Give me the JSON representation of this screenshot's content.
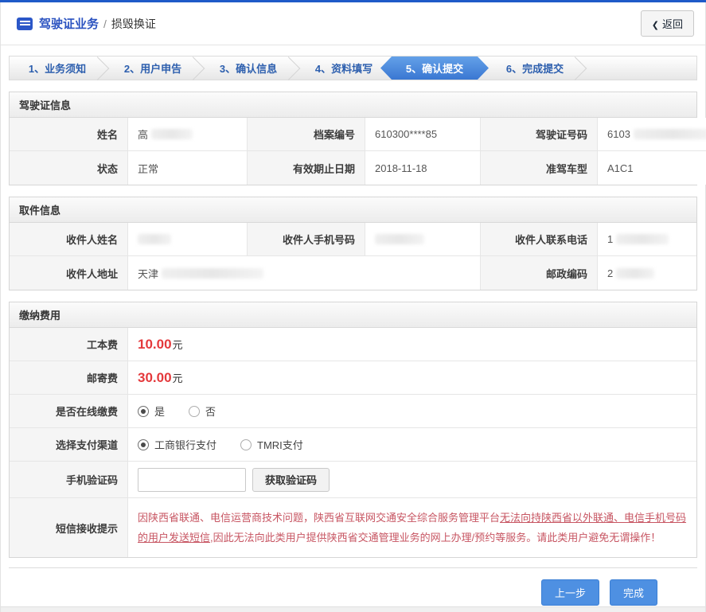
{
  "header": {
    "title": "驾驶证业务",
    "separator": "/",
    "subtitle": "损毁换证",
    "back_chevron": "❮",
    "back_label": "返回"
  },
  "steps": [
    {
      "label": "1、业务须知",
      "active": false
    },
    {
      "label": "2、用户申告",
      "active": false
    },
    {
      "label": "3、确认信息",
      "active": false
    },
    {
      "label": "4、资料填写",
      "active": false
    },
    {
      "label": "5、确认提交",
      "active": true
    },
    {
      "label": "6、完成提交",
      "active": false
    }
  ],
  "license_info": {
    "title": "驾驶证信息",
    "fields": [
      {
        "label": "姓名",
        "value": "高",
        "redacted": true
      },
      {
        "label": "档案编号",
        "value": "610300****85",
        "redacted": false
      },
      {
        "label": "驾驶证号码",
        "value": "6103",
        "redacted": true
      },
      {
        "label": "状态",
        "value": "正常",
        "redacted": false
      },
      {
        "label": "有效期止日期",
        "value": "2018-11-18",
        "redacted": false
      },
      {
        "label": "准驾车型",
        "value": "A1C1",
        "redacted": false
      }
    ]
  },
  "pickup_info": {
    "title": "取件信息",
    "fields": [
      {
        "label": "收件人姓名",
        "value": "",
        "redacted": true
      },
      {
        "label": "收件人手机号码",
        "value": "",
        "redacted": true
      },
      {
        "label": "收件人联系电话",
        "value": "1",
        "redacted": true
      },
      {
        "label": "收件人地址",
        "value": "天津",
        "redacted": true
      },
      {
        "label": "邮政编码",
        "value": "2",
        "redacted": true
      }
    ]
  },
  "payment": {
    "title": "缴纳费用",
    "fees": [
      {
        "label": "工本费",
        "amount": "10.00",
        "unit": "元"
      },
      {
        "label": "邮寄费",
        "amount": "30.00",
        "unit": "元"
      }
    ],
    "online": {
      "label": "是否在线缴费",
      "options": [
        {
          "label": "是",
          "selected": true
        },
        {
          "label": "否",
          "selected": false
        }
      ]
    },
    "channel": {
      "label": "选择支付渠道",
      "options": [
        {
          "label": "工商银行支付",
          "selected": true
        },
        {
          "label": "TMRI支付",
          "selected": false
        }
      ]
    },
    "sms_code": {
      "label": "手机验证码",
      "input_value": "",
      "button_label": "获取验证码"
    },
    "notice": {
      "label": "短信接收提示",
      "text_before": "因陕西省联通、电信运营商技术问题，陕西省互联网交通安全综合服务管理平台",
      "text_underlined": "无法向持陕西省以外联通、电信手机号码的用户发送短信",
      "text_after": ",因此无法向此类用户提供陕西省交通管理业务的网上办理/预约等服务。请此类用户避免无谓操作！"
    }
  },
  "footer": {
    "prev_label": "上一步",
    "finish_label": "完成"
  },
  "colors": {
    "topbar_blue": "#1f5ac8",
    "title_blue": "#2a52c0",
    "step_active_blue": "#3a77d2",
    "fee_red": "#e4393c",
    "notice_red": "#c75562",
    "button_blue": "#4e90e2"
  }
}
